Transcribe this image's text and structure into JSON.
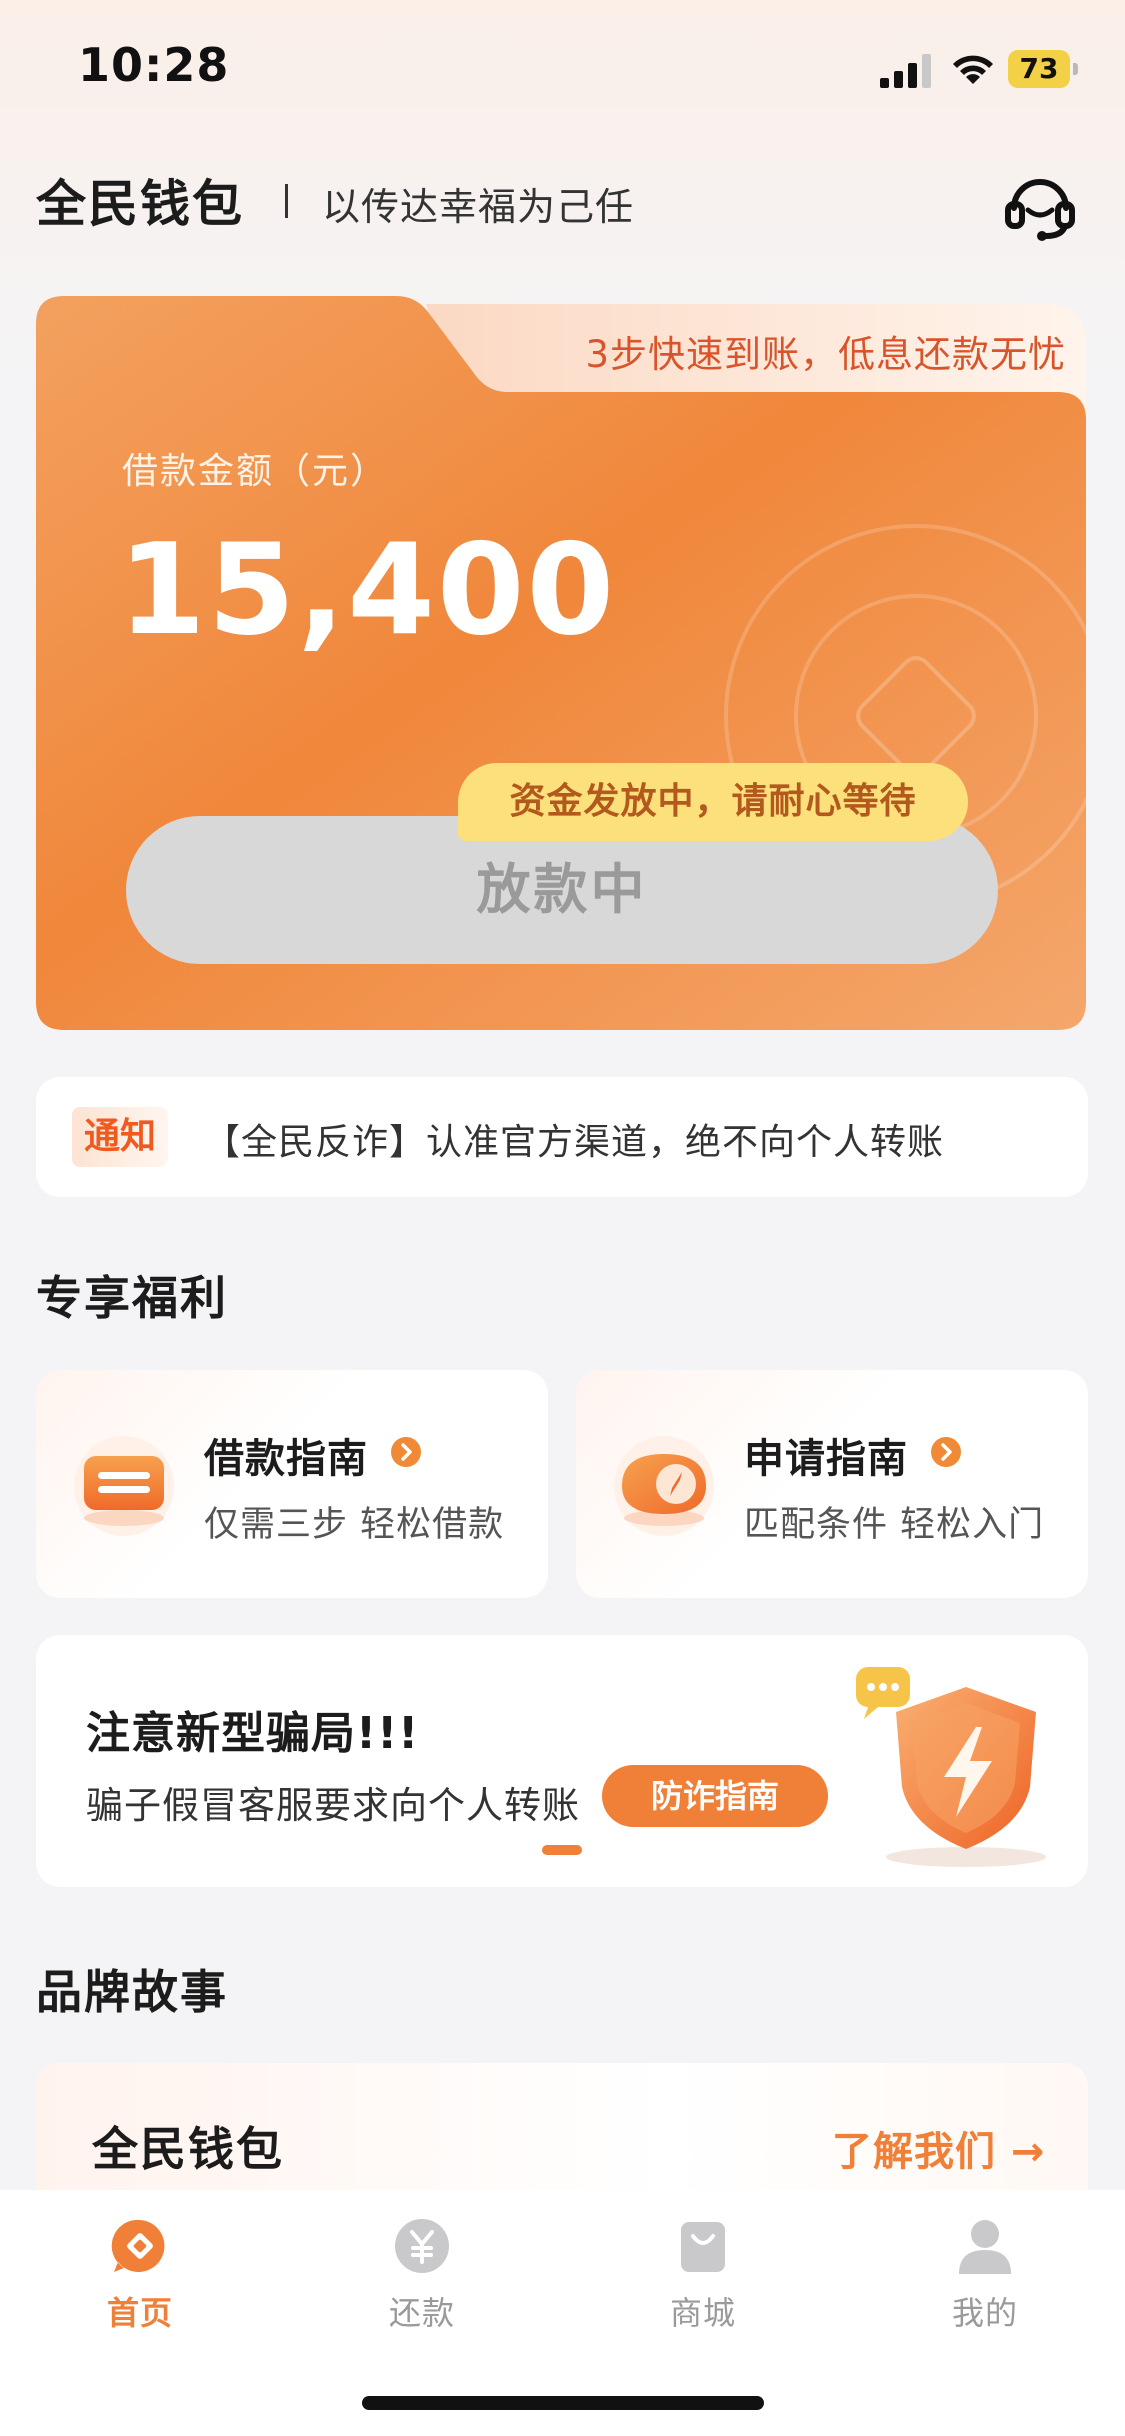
{
  "status_bar": {
    "time": "10:28",
    "battery": "73"
  },
  "header": {
    "brand": "全民钱包",
    "slogan": "以传达幸福为己任"
  },
  "loan_card": {
    "tag_text": "3步快速到账，低息还款无忧",
    "amount_label": "借款金额（元）",
    "amount": "15,400",
    "status_button": "放款中",
    "tip": "资金发放中，请耐心等待"
  },
  "notice": {
    "tag": "通知",
    "text": "【全民反诈】认准官方渠道，绝不向个人转账"
  },
  "welfare": {
    "title": "专享福利",
    "cards": [
      {
        "title": "借款指南",
        "subtitle": "仅需三步 轻松借款",
        "icon": "ticket-icon"
      },
      {
        "title": "申请指南",
        "subtitle": "匹配条件 轻松入门",
        "icon": "compass-icon"
      }
    ]
  },
  "fraud_banner": {
    "title": "注意新型骗局!!!",
    "text": "骗子假冒客服要求向个人转账",
    "button": "防诈指南",
    "icon": "shield-lightning-icon"
  },
  "brand_story": {
    "title": "品牌故事",
    "card_title": "全民钱包",
    "link": "了解我们 →"
  },
  "tab_bar": {
    "items": [
      {
        "label": "首页",
        "icon": "home-icon",
        "active": true
      },
      {
        "label": "还款",
        "icon": "yuan-icon",
        "active": false
      },
      {
        "label": "商城",
        "icon": "shopping-bag-icon",
        "active": false
      },
      {
        "label": "我的",
        "icon": "user-icon",
        "active": false
      }
    ]
  },
  "colors": {
    "accent": "#f07f37",
    "card_orange": "#f08438",
    "tip_yellow": "#fbe07c",
    "notice_red": "#f05a1e"
  }
}
